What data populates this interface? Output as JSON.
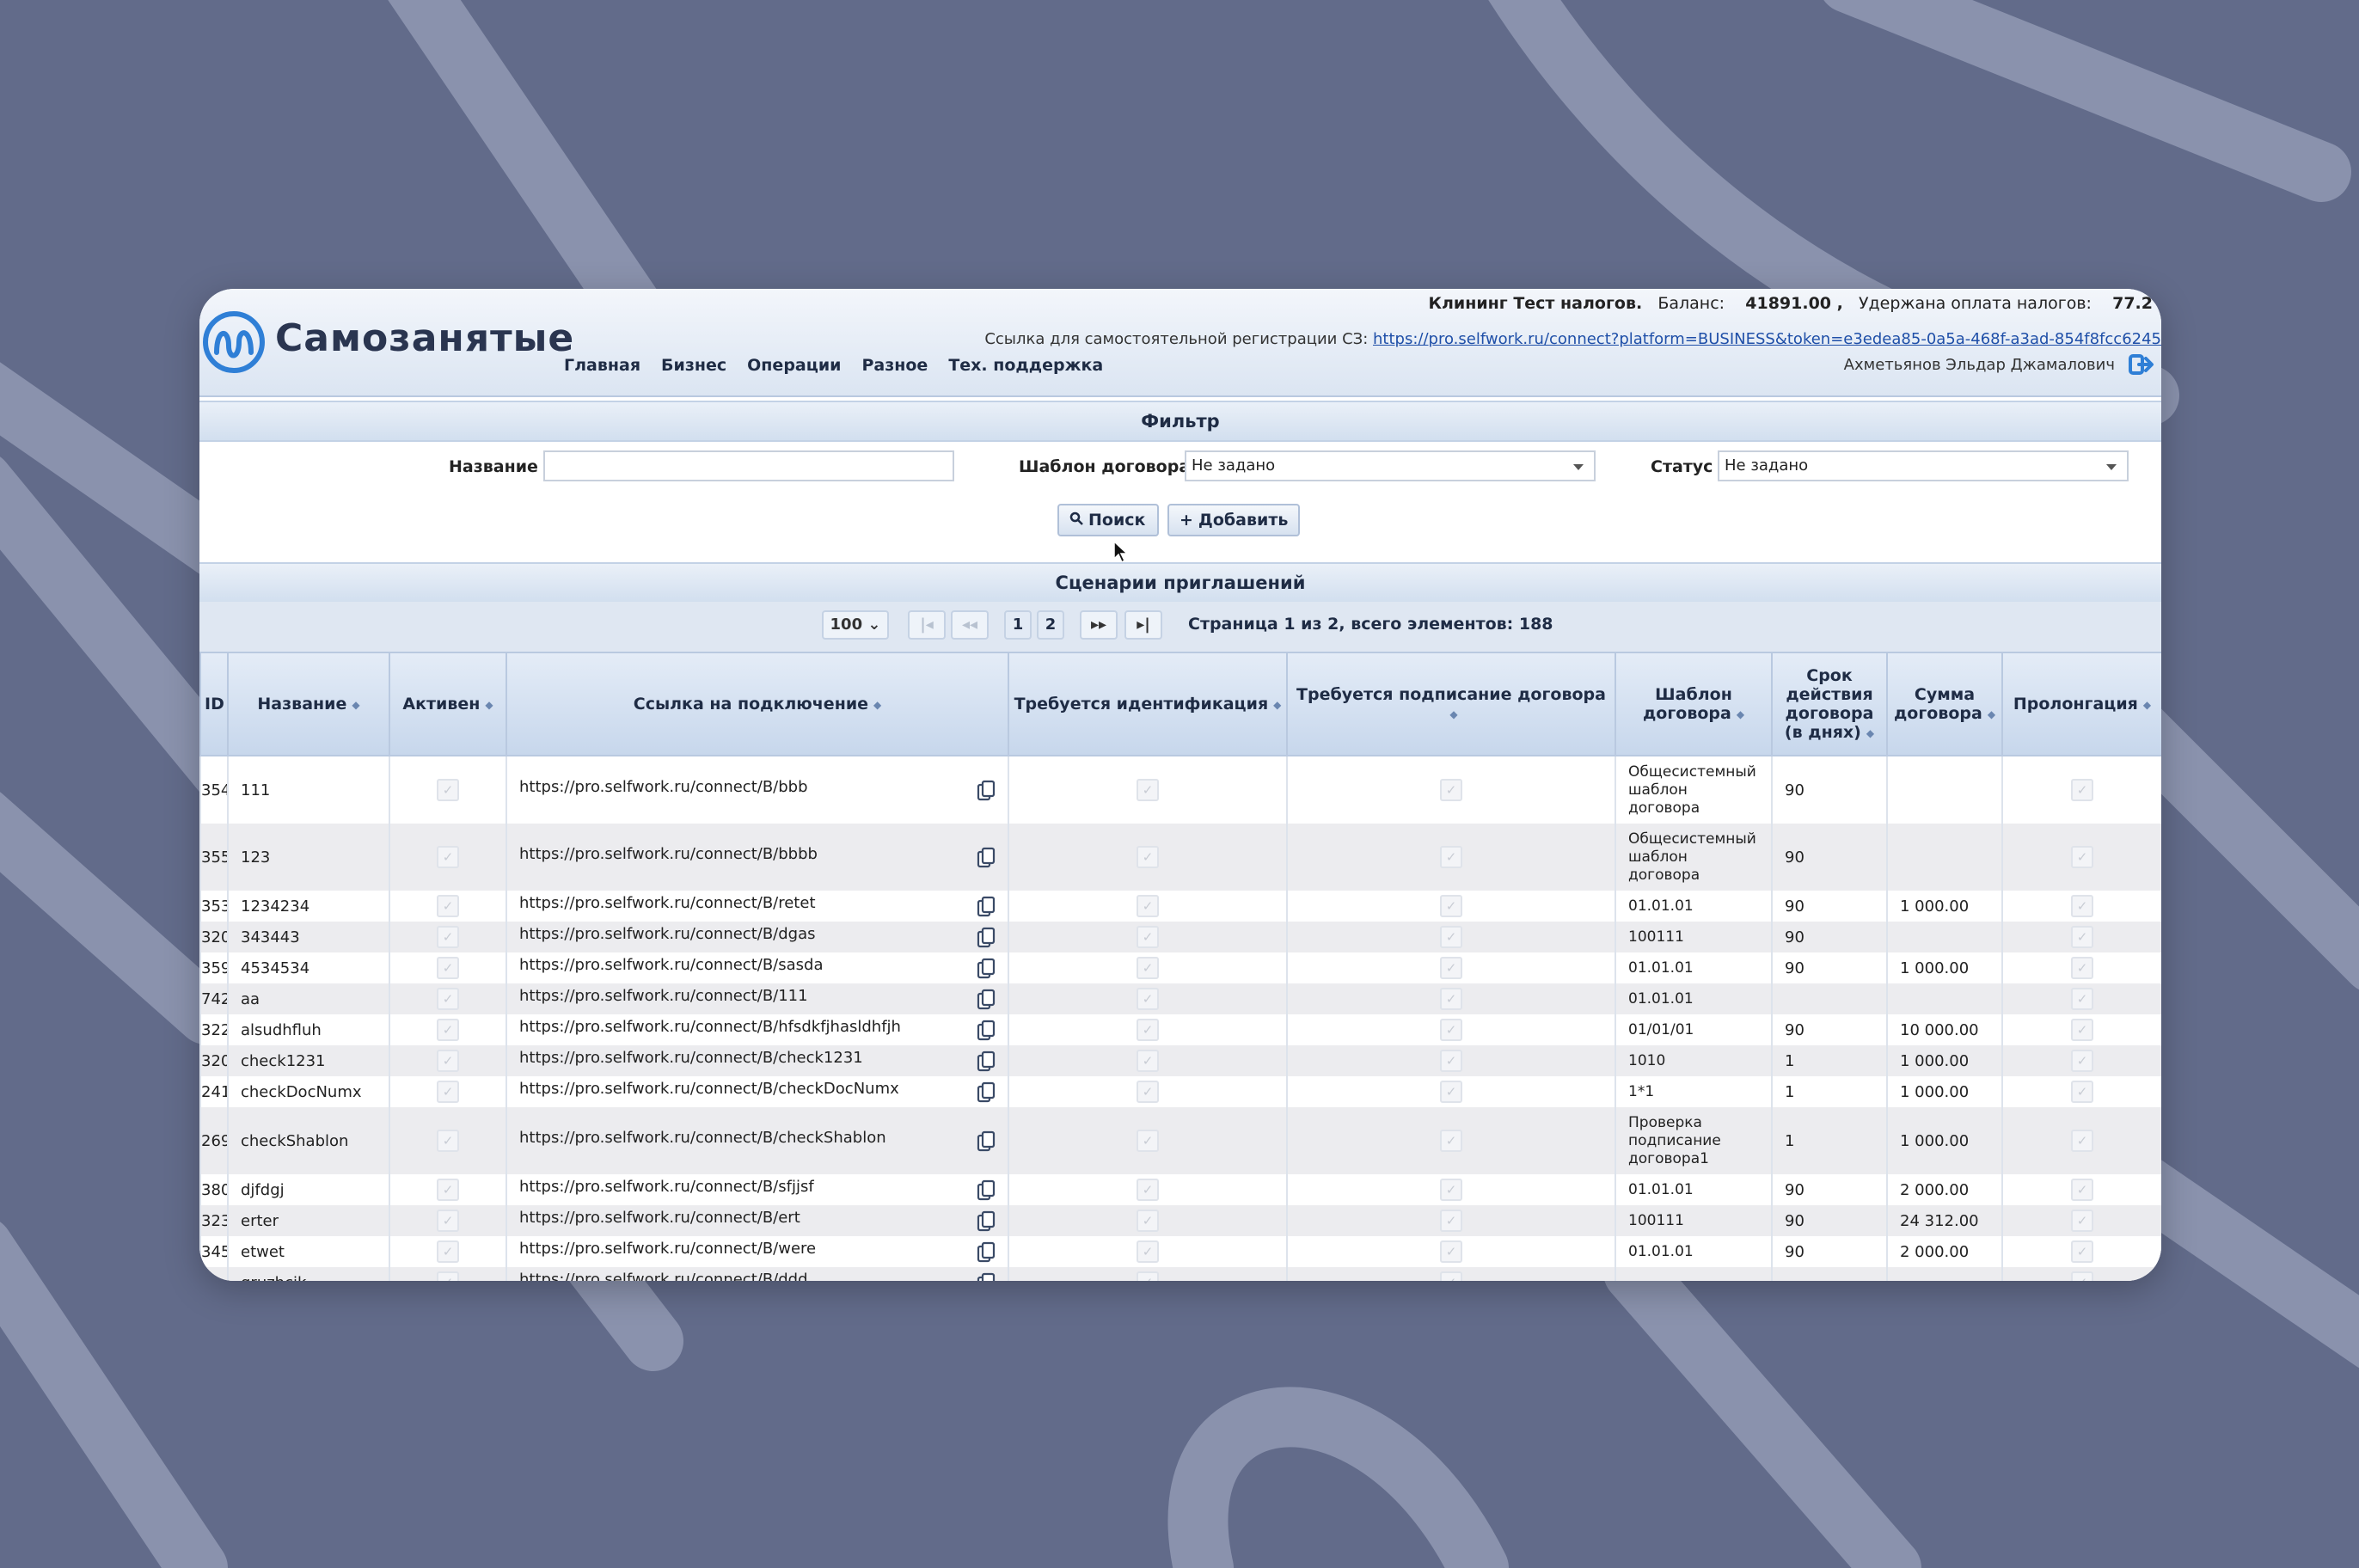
{
  "header": {
    "brand": "Самозанятые",
    "company": "Клининг Тест налогов.",
    "balance_label": "Баланс:",
    "balance_value": "41891.00 ,",
    "tax_label": "Удержана оплата налогов:",
    "tax_value": "77.2",
    "reg_label": "Ссылка для самостоятельной регистрации СЗ:",
    "reg_link": "https://pro.selfwork.ru/connect?platform=BUSINESS&token=e3edea85-0a5a-468f-a3ad-854f8fcc6245",
    "nav": [
      "Главная",
      "Бизнес",
      "Операции",
      "Разное",
      "Тех. поддержка"
    ],
    "user": "Ахметьянов Эльдар Джамалович"
  },
  "filter": {
    "title": "Фильтр",
    "name_label": "Название",
    "name_value": "",
    "template_label": "Шаблон договора",
    "template_value": "Не задано",
    "status_label": "Статус",
    "status_value": "Не задано",
    "search_button": "Поиск",
    "add_button": "Добавить"
  },
  "table_section": {
    "title": "Сценарии приглашений",
    "page_size": "100",
    "pages": [
      "1",
      "2"
    ],
    "page_info": "Страница 1 из 2, всего элементов: 188"
  },
  "columns": [
    "ID",
    "Название",
    "Активен",
    "Ссылка на подключение",
    "Требуется идентификация",
    "Требуется подписание договора",
    "Шаблон договора",
    "Срок действия договора (в днях)",
    "Сумма договора",
    "Пролонгация"
  ],
  "rows": [
    {
      "id": "354",
      "name": "111",
      "link": "https://pro.selfwork.ru/connect/B/bbb",
      "template": "Общесистемный шаблон договора",
      "term": "90",
      "sum": "",
      "tall": true
    },
    {
      "id": "355",
      "name": "123",
      "link": "https://pro.selfwork.ru/connect/B/bbbb",
      "template": "Общесистемный шаблон договора",
      "term": "90",
      "sum": "",
      "tall": true
    },
    {
      "id": "353",
      "name": "1234234",
      "link": "https://pro.selfwork.ru/connect/B/retet",
      "template": "01.01.01",
      "term": "90",
      "sum": "1 000.00"
    },
    {
      "id": "320",
      "name": "343443",
      "link": "https://pro.selfwork.ru/connect/B/dgas",
      "template": "100111",
      "term": "90",
      "sum": ""
    },
    {
      "id": "359",
      "name": "4534534",
      "link": "https://pro.selfwork.ru/connect/B/sasda",
      "template": "01.01.01",
      "term": "90",
      "sum": "1 000.00"
    },
    {
      "id": "742",
      "name": "aa",
      "link": "https://pro.selfwork.ru/connect/B/111",
      "template": "01.01.01",
      "term": "",
      "sum": ""
    },
    {
      "id": "322",
      "name": "alsudhfluh",
      "link": "https://pro.selfwork.ru/connect/B/hfsdkfjhasldhfjh",
      "template": "01/01/01",
      "term": "90",
      "sum": "10 000.00"
    },
    {
      "id": "320",
      "name": "check1231",
      "link": "https://pro.selfwork.ru/connect/B/check1231",
      "template": "1010",
      "term": "1",
      "sum": "1 000.00"
    },
    {
      "id": "241",
      "name": "checkDocNumx",
      "link": "https://pro.selfwork.ru/connect/B/checkDocNumx",
      "template": "1*1",
      "term": "1",
      "sum": "1 000.00"
    },
    {
      "id": "269",
      "name": "checkShablon",
      "link": "https://pro.selfwork.ru/connect/B/checkShablon",
      "template": "Проверка подписание договора1",
      "term": "1",
      "sum": "1 000.00",
      "tall": true
    },
    {
      "id": "380",
      "name": "djfdgj",
      "link": "https://pro.selfwork.ru/connect/B/sfjjsf",
      "template": "01.01.01",
      "term": "90",
      "sum": "2 000.00"
    },
    {
      "id": "323",
      "name": "erter",
      "link": "https://pro.selfwork.ru/connect/B/ert",
      "template": "100111",
      "term": "90",
      "sum": "24 312.00"
    },
    {
      "id": "345",
      "name": "etwet",
      "link": "https://pro.selfwork.ru/connect/B/were",
      "template": "01.01.01",
      "term": "90",
      "sum": "2 000.00"
    },
    {
      "id": "",
      "name": "gruzhcik",
      "link": "https://pro.selfwork.ru/connect/B/ddd",
      "template": "",
      "term": "",
      "sum": ""
    }
  ],
  "icons": {
    "search": "search-icon",
    "add": "plus-icon",
    "copy": "copy-icon",
    "logout": "logout-icon",
    "sort": "sort-icon",
    "check": "checkbox-icon"
  },
  "colors": {
    "background": "#626b8a",
    "accent": "#1f4fa8",
    "header": "#dbe5f2"
  }
}
